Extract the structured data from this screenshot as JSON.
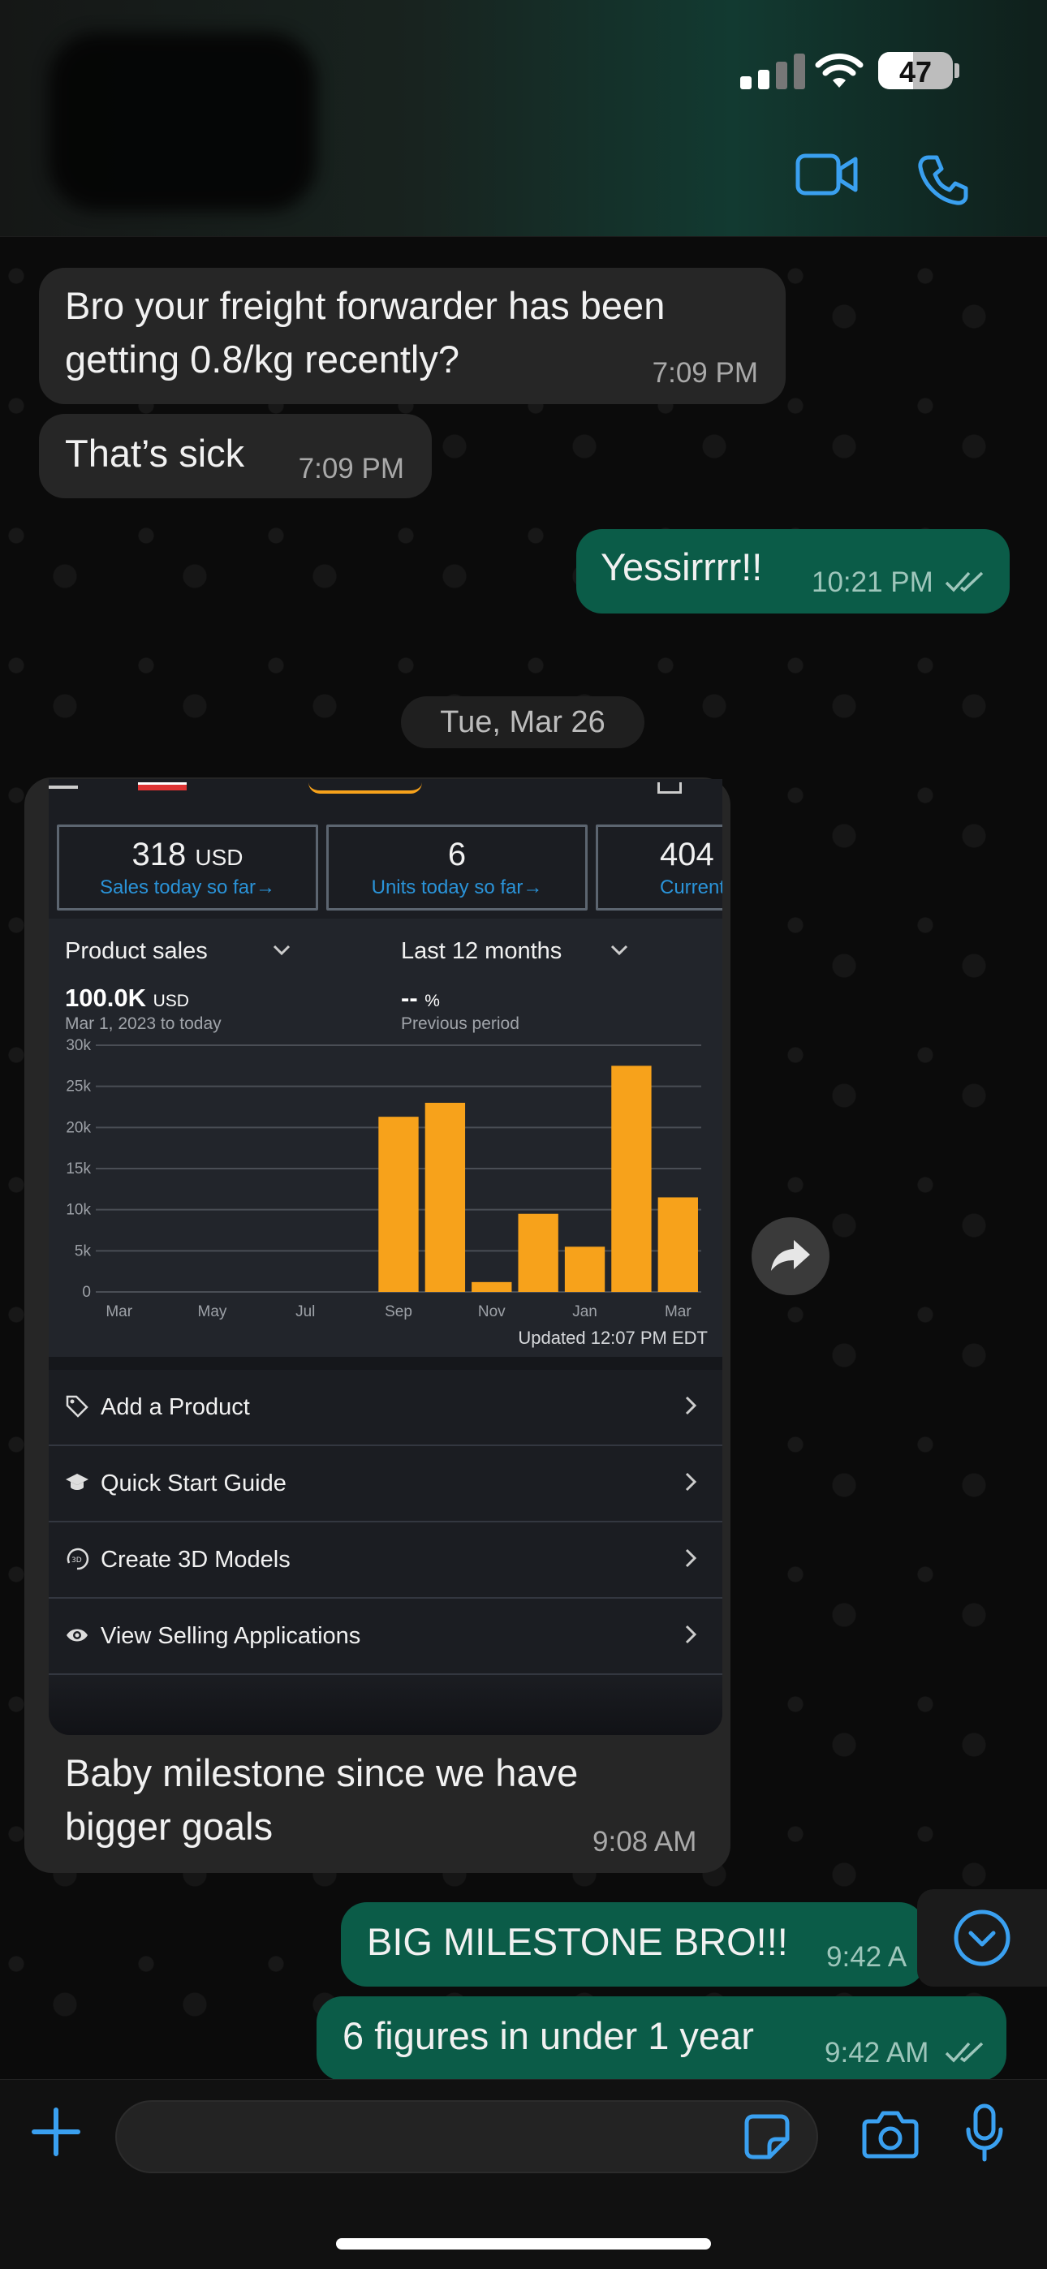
{
  "status_bar": {
    "battery": "47"
  },
  "header": {
    "icons": [
      "video-call-icon",
      "voice-call-icon"
    ]
  },
  "messages": {
    "m1": {
      "text": "Bro your freight forwarder has been getting 0.8/kg recently?",
      "time": "7:09 PM"
    },
    "m2": {
      "text": "That’s sick",
      "time": "7:09 PM"
    },
    "m3": {
      "text": "Yessirrrr!!",
      "time": "10:21 PM"
    },
    "date_divider": "Tue, Mar 26",
    "m4": {
      "text": "Baby milestone since we have bigger goals",
      "time": "9:08 AM"
    },
    "m5": {
      "text": "BIG MILESTONE BRO!!!",
      "time": "9:42 A"
    },
    "m6": {
      "text": "6 figures in under 1 year",
      "time": "9:42 AM"
    }
  },
  "screenshot": {
    "kpis": [
      {
        "value": "318",
        "unit": "USD",
        "label": "Sales today so far",
        "arrow": "→"
      },
      {
        "value": "6",
        "unit": "",
        "label": "Units today so far",
        "arrow": "→"
      },
      {
        "value": "404",
        "unit": "",
        "label": "Current b",
        "arrow": ""
      }
    ],
    "metric_select": "Product sales",
    "period_select": "Last 12 months",
    "total_value": "100.0K",
    "total_unit": "USD",
    "total_range": "Mar 1, 2023 to today",
    "prev_value": "--",
    "prev_unit": "%",
    "prev_label": "Previous period",
    "updated": "Updated 12:07 PM EDT",
    "menu": [
      {
        "label": "Add a Product",
        "icon": "tag-icon"
      },
      {
        "label": "Quick Start Guide",
        "icon": "graduation-cap-icon"
      },
      {
        "label": "Create 3D Models",
        "icon": "3d-rotate-icon"
      },
      {
        "label": "View Selling Applications",
        "icon": "eye-icon"
      }
    ]
  },
  "chart_data": {
    "type": "bar",
    "categories": [
      "Mar",
      "Apr",
      "May",
      "Jun",
      "Jul",
      "Aug",
      "Sep",
      "Oct",
      "Nov",
      "Dec",
      "Jan",
      "Feb",
      "Mar"
    ],
    "values": [
      0,
      0,
      0,
      0,
      0,
      0,
      21300,
      23000,
      1200,
      9500,
      5500,
      27500,
      11500
    ],
    "x_tick_labels": [
      "Mar",
      "May",
      "Jul",
      "Sep",
      "Nov",
      "Jan",
      "Mar"
    ],
    "y_ticks": [
      "0",
      "5k",
      "10k",
      "15k",
      "20k",
      "25k",
      "30k"
    ],
    "ylim": [
      0,
      30000
    ],
    "bar_color": "#f7a21b",
    "grid": true
  },
  "colors": {
    "outgoing_bubble": "#0b5c48",
    "incoming_bubble": "#262626",
    "accent_blue": "#3aa0f0",
    "link_blue": "#2a93d8"
  }
}
